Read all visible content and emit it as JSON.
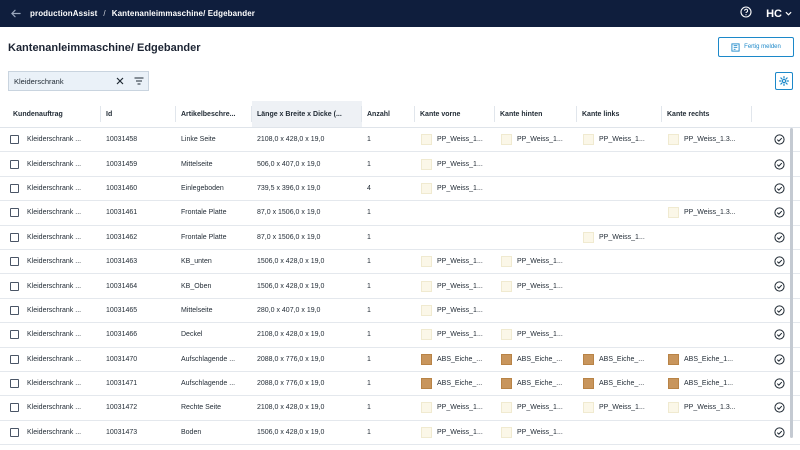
{
  "topbar": {
    "app": "productionAssist",
    "sep": "/",
    "current": "Kantenanleimmaschine/ Edgebander",
    "brand": "HC"
  },
  "page": {
    "title": "Kantenanleimmaschine/ Edgebander",
    "done_button": "Fertig melden"
  },
  "filter": {
    "value": "Kleiderschrank"
  },
  "table": {
    "headers": {
      "kunde": "Kundenauftrag",
      "id": "Id",
      "artikel": "Artikelbeschre...",
      "mass": "Länge x Breite x Dicke (...",
      "anzahl": "Anzahl",
      "vorne": "Kante vorne",
      "hinten": "Kante hinten",
      "links": "Kante links",
      "rechts": "Kante rechts"
    },
    "rows": [
      {
        "kunde": "Kleiderschrank ...",
        "id": "10031458",
        "artikel": "Linke Seite",
        "mass": "2108,0 x 428,0 x 19,0",
        "anzahl": "1",
        "vorne": "PP_Weiss_1...",
        "hinten": "PP_Weiss_1...",
        "links": "PP_Weiss_1...",
        "rechts": "PP_Weiss_1.3..."
      },
      {
        "kunde": "Kleiderschrank ...",
        "id": "10031459",
        "artikel": "Mittelseite",
        "mass": "506,0 x 407,0 x 19,0",
        "anzahl": "1",
        "vorne": "PP_Weiss_1...",
        "hinten": "",
        "links": "",
        "rechts": ""
      },
      {
        "kunde": "Kleiderschrank ...",
        "id": "10031460",
        "artikel": "Einlegeboden",
        "mass": "739,5 x 396,0 x 19,0",
        "anzahl": "4",
        "vorne": "PP_Weiss_1...",
        "hinten": "",
        "links": "",
        "rechts": ""
      },
      {
        "kunde": "Kleiderschrank ...",
        "id": "10031461",
        "artikel": "Frontale Platte",
        "mass": "87,0 x 1506,0 x 19,0",
        "anzahl": "1",
        "vorne": "",
        "hinten": "",
        "links": "",
        "rechts": "PP_Weiss_1.3..."
      },
      {
        "kunde": "Kleiderschrank ...",
        "id": "10031462",
        "artikel": "Frontale Platte",
        "mass": "87,0 x 1506,0 x 19,0",
        "anzahl": "1",
        "vorne": "",
        "hinten": "",
        "links": "PP_Weiss_1...",
        "rechts": ""
      },
      {
        "kunde": "Kleiderschrank ...",
        "id": "10031463",
        "artikel": "KB_unten",
        "mass": "1506,0 x 428,0 x 19,0",
        "anzahl": "1",
        "vorne": "PP_Weiss_1...",
        "hinten": "PP_Weiss_1...",
        "links": "",
        "rechts": ""
      },
      {
        "kunde": "Kleiderschrank ...",
        "id": "10031464",
        "artikel": "KB_Oben",
        "mass": "1506,0 x 428,0 x 19,0",
        "anzahl": "1",
        "vorne": "PP_Weiss_1...",
        "hinten": "PP_Weiss_1...",
        "links": "",
        "rechts": ""
      },
      {
        "kunde": "Kleiderschrank ...",
        "id": "10031465",
        "artikel": "Mittelseite",
        "mass": "280,0 x 407,0 x 19,0",
        "anzahl": "1",
        "vorne": "PP_Weiss_1...",
        "hinten": "",
        "links": "",
        "rechts": ""
      },
      {
        "kunde": "Kleiderschrank ...",
        "id": "10031466",
        "artikel": "Deckel",
        "mass": "2108,0 x 428,0 x 19,0",
        "anzahl": "1",
        "vorne": "PP_Weiss_1...",
        "hinten": "PP_Weiss_1...",
        "links": "",
        "rechts": ""
      },
      {
        "kunde": "Kleiderschrank ...",
        "id": "10031470",
        "artikel": "Aufschlagende ...",
        "mass": "2088,0 x 776,0 x 19,0",
        "anzahl": "1",
        "vorne": "ABS_Eiche_...",
        "hinten": "ABS_Eiche_...",
        "links": "ABS_Eiche_...",
        "rechts": "ABS_Eiche_1..."
      },
      {
        "kunde": "Kleiderschrank ...",
        "id": "10031471",
        "artikel": "Aufschlagende ...",
        "mass": "2088,0 x 776,0 x 19,0",
        "anzahl": "1",
        "vorne": "ABS_Eiche_...",
        "hinten": "ABS_Eiche_...",
        "links": "ABS_Eiche_...",
        "rechts": "ABS_Eiche_1..."
      },
      {
        "kunde": "Kleiderschrank ...",
        "id": "10031472",
        "artikel": "Rechte Seite",
        "mass": "2108,0 x 428,0 x 19,0",
        "anzahl": "1",
        "vorne": "PP_Weiss_1...",
        "hinten": "PP_Weiss_1...",
        "links": "PP_Weiss_1...",
        "rechts": "PP_Weiss_1.3..."
      },
      {
        "kunde": "Kleiderschrank ...",
        "id": "10031473",
        "artikel": "Boden",
        "mass": "1506,0 x 428,0 x 19,0",
        "anzahl": "1",
        "vorne": "PP_Weiss_1...",
        "hinten": "PP_Weiss_1...",
        "links": "",
        "rechts": ""
      }
    ]
  },
  "colors": {
    "topbar": "#0f1e3d",
    "accent": "#1c88c9",
    "weiss_swatch": "#fbf7e8",
    "eiche_swatch": "#c8955c"
  },
  "icons": {
    "back": "arrow-left-icon",
    "help": "help-circle-icon",
    "clear": "close-icon",
    "filter": "filter-icon",
    "settings": "gear-icon",
    "done": "check-circle-icon",
    "done_button": "flag-icon"
  }
}
